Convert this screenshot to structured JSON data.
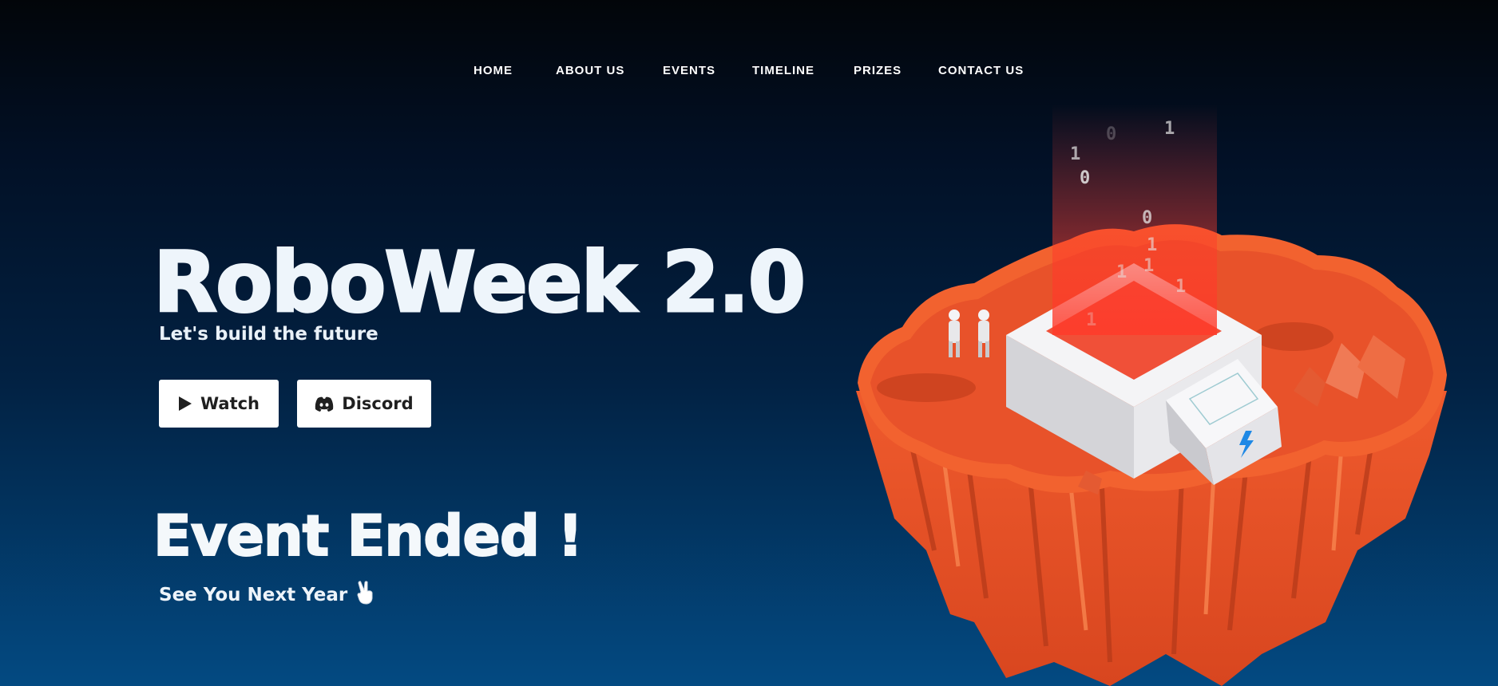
{
  "nav": {
    "items": [
      {
        "label": "HOME"
      },
      {
        "label": "ABOUT US"
      },
      {
        "label": "EVENTS"
      },
      {
        "label": "TIMELINE"
      },
      {
        "label": "PRIZES"
      },
      {
        "label": "CONTACT US"
      }
    ]
  },
  "hero": {
    "title": "RoboWeek 2.0",
    "tagline": "Let's build the future",
    "buttons": {
      "watch_label": "Watch",
      "watch_icon": "play-icon",
      "discord_label": "Discord",
      "discord_icon": "discord-icon"
    }
  },
  "status": {
    "heading": "Event Ended !",
    "subtext": "See You Next Year",
    "subtext_icon": "victory-hand-icon"
  },
  "illustration": {
    "name": "floating-island-illustration",
    "binary_digits": [
      "1",
      "0",
      "0",
      "1",
      "0",
      "1",
      "1",
      "1",
      "1",
      "1"
    ]
  },
  "colors": {
    "background_top": "#020509",
    "background_bottom": "#034a82",
    "text": "#ffffff",
    "button_bg": "#ffffff",
    "button_text": "#1f1f1f",
    "island_orange": "#f05a2c",
    "island_shadow": "#c23d1b",
    "platform_white": "#f2f2f4",
    "beam_red": "#ff3a2a"
  }
}
